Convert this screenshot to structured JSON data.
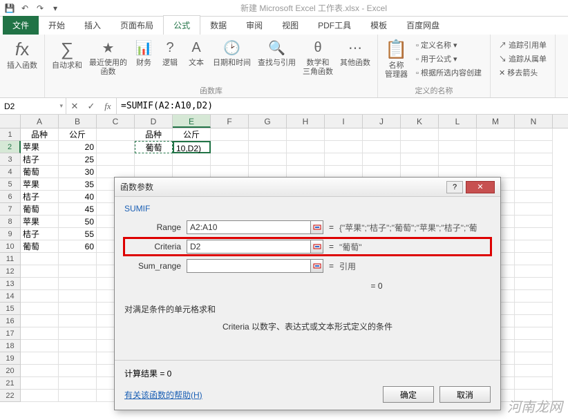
{
  "titlebar": {
    "title": "新建 Microsoft Excel 工作表.xlsx - Excel"
  },
  "tabs": {
    "file": "文件",
    "home": "开始",
    "insert": "插入",
    "layout": "页面布局",
    "formula": "公式",
    "data": "数据",
    "review": "审阅",
    "view": "视图",
    "pdf": "PDF工具",
    "template": "模板",
    "baidu": "百度网盘"
  },
  "ribbon": {
    "insert_fn": "插入函数",
    "autosum": "自动求和",
    "recent": "最近使用的\n函数",
    "financial": "财务",
    "logical": "逻辑",
    "text": "文本",
    "datetime": "日期和时间",
    "lookup": "查找与引用",
    "math": "数学和\n三角函数",
    "other": "其他函数",
    "group_lib": "函数库",
    "namemgr": "名称\n管理器",
    "define": "定义名称",
    "usefor": "用于公式",
    "createfrom": "根据所选内容创建",
    "group_names": "定义的名称",
    "trace_prec": "追踪引用单",
    "trace_dep": "追踪从属单",
    "remove_arrows": "移去箭头"
  },
  "formula_bar": {
    "namebox": "D2",
    "formula": "=SUMIF(A2:A10,D2)"
  },
  "columns": [
    "A",
    "B",
    "C",
    "D",
    "E",
    "F",
    "G",
    "H",
    "I",
    "J",
    "K",
    "L",
    "M",
    "N"
  ],
  "rownums": [
    "1",
    "2",
    "3",
    "4",
    "5",
    "6",
    "7",
    "8",
    "9",
    "10",
    "11",
    "12",
    "13",
    "14",
    "15",
    "16",
    "17",
    "18",
    "19",
    "20",
    "21",
    "22"
  ],
  "sheet": {
    "headers": {
      "a1": "品种",
      "b1": "公斤",
      "d1": "品种",
      "e1": "公斤"
    },
    "rows": [
      {
        "a": "苹果",
        "b": "20"
      },
      {
        "a": "桔子",
        "b": "25"
      },
      {
        "a": "葡萄",
        "b": "30"
      },
      {
        "a": "苹果",
        "b": "35"
      },
      {
        "a": "桔子",
        "b": "40"
      },
      {
        "a": "葡萄",
        "b": "45"
      },
      {
        "a": "苹果",
        "b": "50"
      },
      {
        "a": "桔子",
        "b": "55"
      },
      {
        "a": "葡萄",
        "b": "60"
      }
    ],
    "d2": "葡萄",
    "e2": "10,D2)"
  },
  "dialog": {
    "title": "函数参数",
    "func": "SUMIF",
    "args": {
      "range_label": "Range",
      "range_value": "A2:A10",
      "range_result": "{\"苹果\";\"桔子\";\"葡萄\";\"苹果\";\"桔子\";\"葡",
      "criteria_label": "Criteria",
      "criteria_value": "D2",
      "criteria_result": "\"葡萄\"",
      "sumrange_label": "Sum_range",
      "sumrange_value": "",
      "sumrange_result": "引用"
    },
    "eq_zero": "=  0",
    "desc1": "对满足条件的单元格求和",
    "desc2": "Criteria  以数字、表达式或文本形式定义的条件",
    "calc_result": "计算结果 =  0",
    "help": "有关该函数的帮助(H)",
    "ok": "确定",
    "cancel": "取消"
  },
  "watermark": "河南龙网"
}
